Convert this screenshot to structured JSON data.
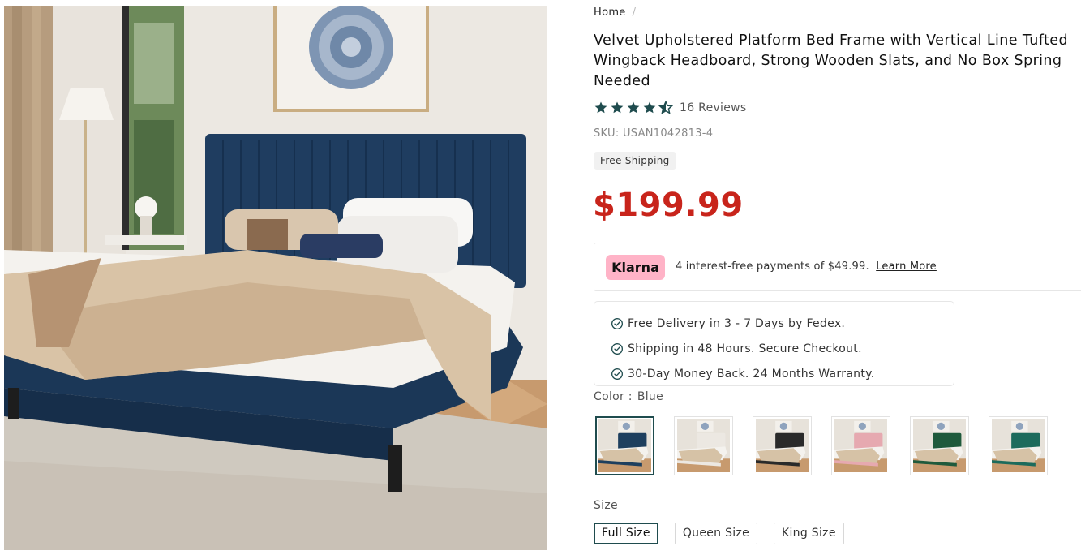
{
  "breadcrumb": {
    "home": "Home",
    "separator": "/"
  },
  "product": {
    "title": "Velvet Upholstered Platform Bed Frame with Vertical Line Tufted Wingback Headboard, Strong Wooden Slats, and No Box Spring Needed",
    "rating": 4.5,
    "reviews_label": "16 Reviews",
    "sku": "SKU: USAN1042813-4",
    "shipping_badge": "Free Shipping",
    "price": "$199.99"
  },
  "klarna": {
    "logo": "Klarna",
    "text": "4 interest-free payments of $49.99.",
    "link": "Learn More"
  },
  "benefits": [
    "Free Delivery in 3 - 7 Days by Fedex.",
    "Shipping in 48 Hours. Secure Checkout.",
    "30-Day Money Back. 24 Months Warranty."
  ],
  "color": {
    "label": "Color :",
    "value": "Blue",
    "options": [
      {
        "name": "Blue",
        "hex": "#1e3f5e",
        "selected": true
      },
      {
        "name": "White",
        "hex": "#ece8e2",
        "selected": false
      },
      {
        "name": "Black",
        "hex": "#2a2a2a",
        "selected": false
      },
      {
        "name": "Pink",
        "hex": "#e6a9b0",
        "selected": false
      },
      {
        "name": "Green",
        "hex": "#1f5a3c",
        "selected": false
      },
      {
        "name": "Teal",
        "hex": "#1d6b5c",
        "selected": false
      }
    ]
  },
  "size": {
    "label": "Size",
    "options": [
      {
        "label": "Full Size",
        "selected": true
      },
      {
        "label": "Queen Size",
        "selected": false
      },
      {
        "label": "King Size",
        "selected": false
      }
    ]
  },
  "colors": {
    "accent": "#1f4c4e",
    "price": "#c8241b",
    "star": "#1f4c4e",
    "klarna": "#ffb3c7"
  },
  "icons": {
    "star": "star-icon",
    "check": "check-circle-icon"
  }
}
